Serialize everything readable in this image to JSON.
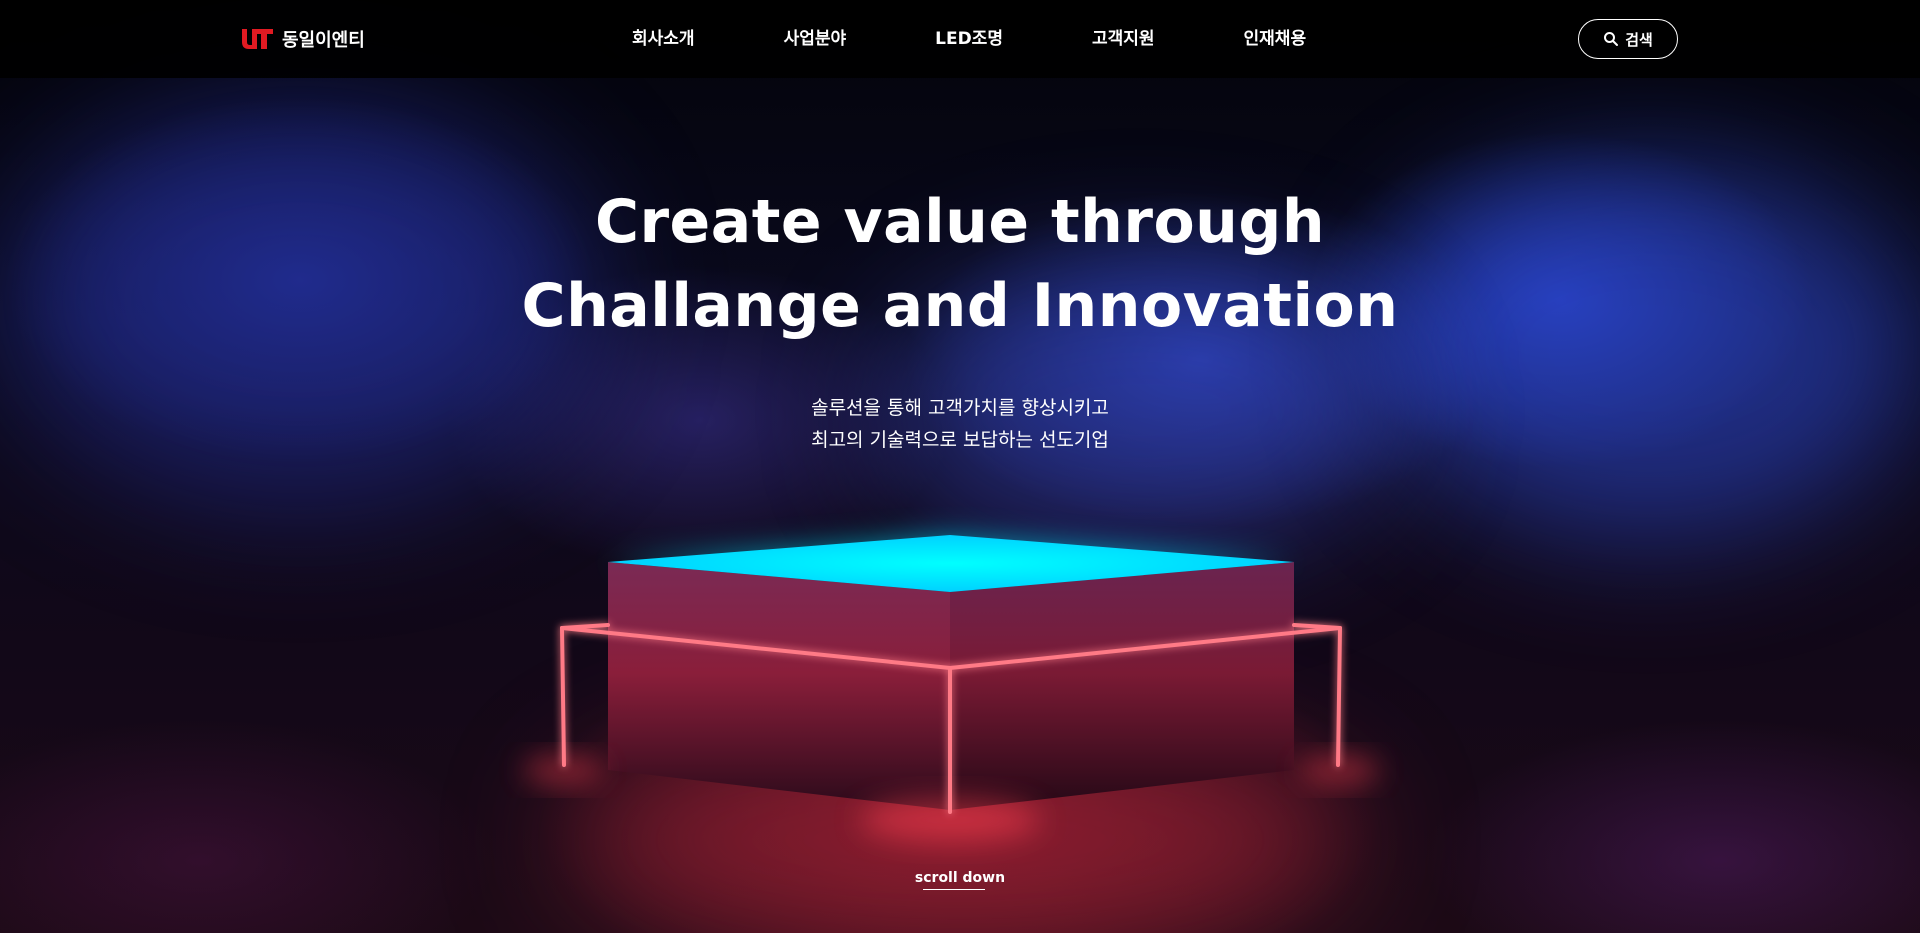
{
  "header": {
    "logo_text": "동일이엔티",
    "nav": [
      {
        "label": "회사소개"
      },
      {
        "label": "사업분야"
      },
      {
        "label": "LED조명"
      },
      {
        "label": "고객지원"
      },
      {
        "label": "인재채용"
      }
    ],
    "search_label": "검색",
    "search_icon": "search-icon"
  },
  "hero": {
    "title_line1": "Create value through",
    "title_line2": "Challange and Innovation",
    "subtitle_line1": "솔루션을 통해 고객가치를 향상시키고",
    "subtitle_line2": "최고의 기술력으로 보답하는 선도기업",
    "scroll_label": "scroll down"
  },
  "colors": {
    "brand_red": "#e11a22",
    "neon_cyan": "#00f0ff",
    "neon_red": "#ff4a5a",
    "background": "#000000"
  }
}
